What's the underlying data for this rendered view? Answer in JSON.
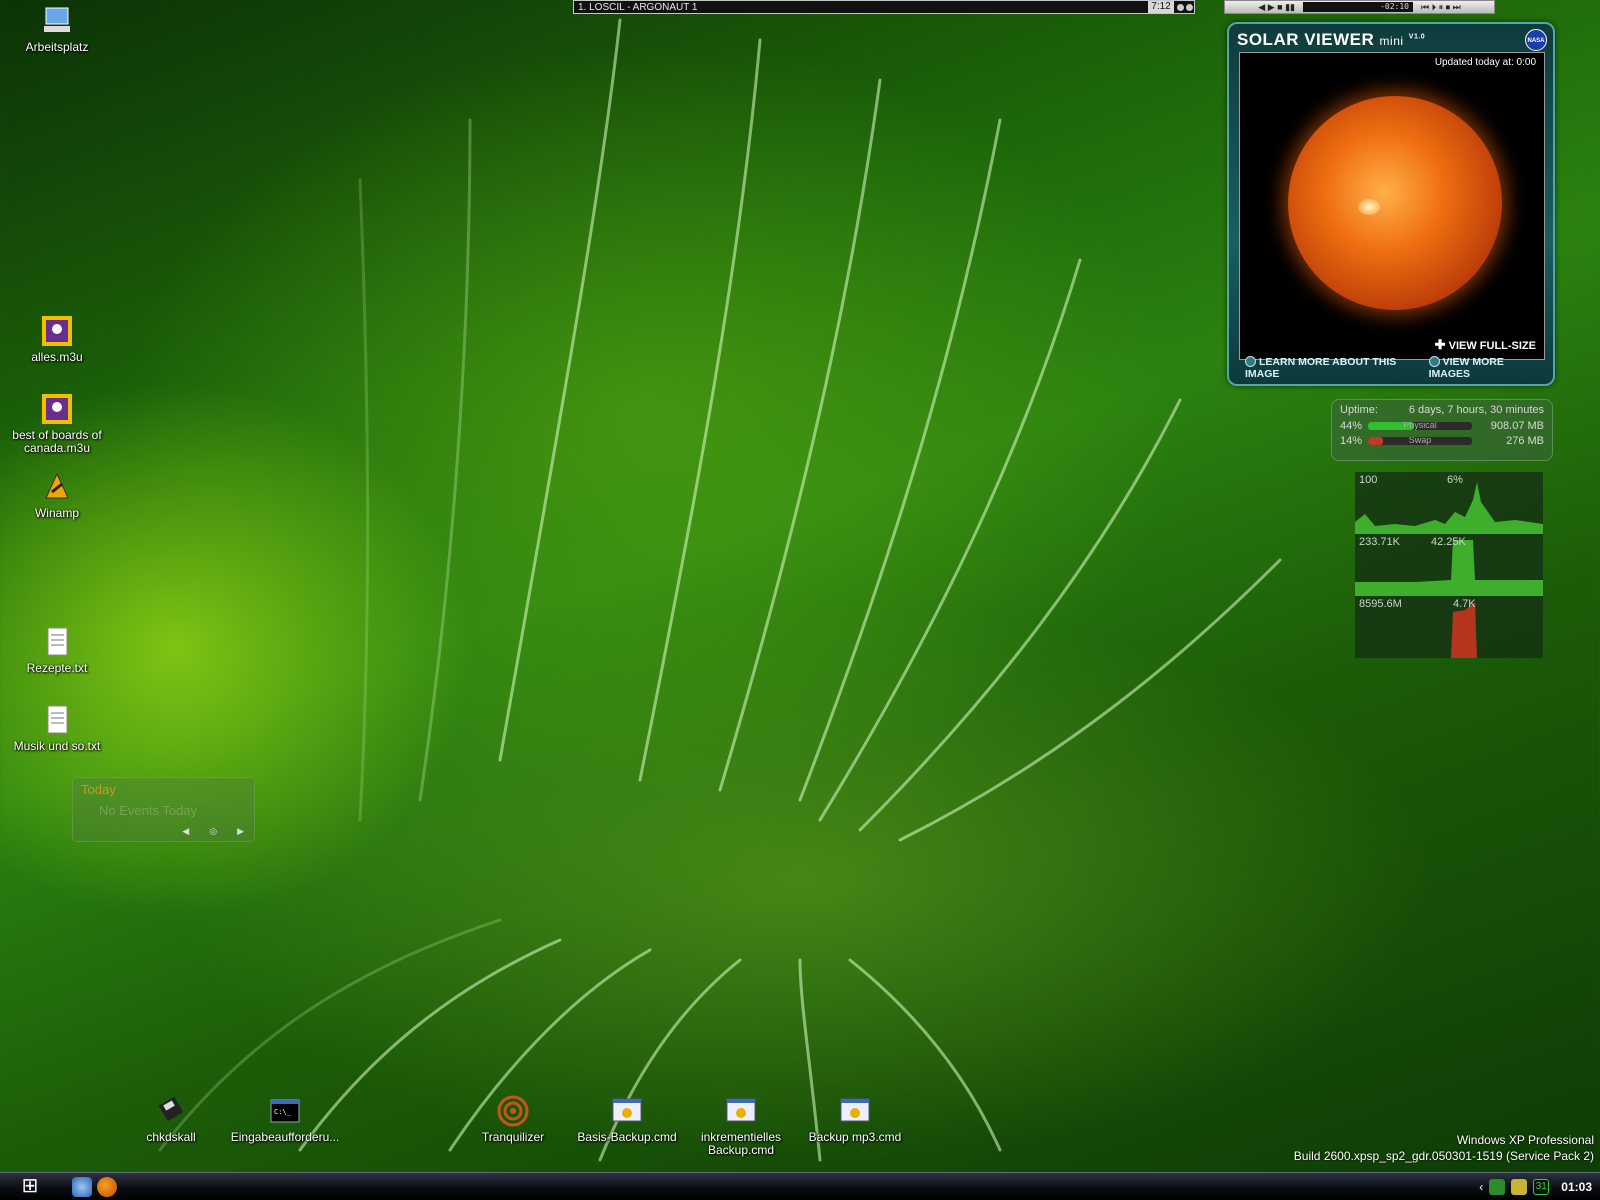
{
  "desktop_icons_left": [
    {
      "label": "Arbeitsplatz",
      "icon": "computer-icon"
    },
    {
      "label": "alles.m3u",
      "icon": "playlist-icon"
    },
    {
      "label": "best of boards of canada.m3u",
      "icon": "playlist-icon"
    },
    {
      "label": "Winamp",
      "icon": "winamp-icon"
    },
    {
      "label": "Rezepte.txt",
      "icon": "text-file-icon"
    },
    {
      "label": "Musik und so.txt",
      "icon": "text-file-icon"
    }
  ],
  "desktop_icons_bottom": [
    {
      "label": "chkdskall",
      "icon": "disk-shortcut-icon"
    },
    {
      "label": "Eingabeaufforderu...",
      "icon": "cmd-icon"
    },
    {
      "label": "Tranquilizer",
      "icon": "spiral-icon"
    },
    {
      "label": "Basis-Backup.cmd",
      "icon": "batch-file-icon"
    },
    {
      "label": "inkrementielles Backup.cmd",
      "icon": "batch-file-icon"
    },
    {
      "label": "Backup mp3.cmd",
      "icon": "batch-file-icon"
    }
  ],
  "winamp": {
    "track": "1. LOSCIL - ARGONAUT 1",
    "time": "7:12",
    "mini_display": "-02:10"
  },
  "solar_viewer": {
    "title": "SOLAR VIEWER",
    "title_suffix": "mini",
    "version": "V1.0",
    "badge": "NASA",
    "updated": "Updated today at: 0:00",
    "view_full": "VIEW FULL-SIZE",
    "link_learn": "LEARN MORE ABOUT THIS IMAGE",
    "link_more": "VIEW MORE IMAGES"
  },
  "uptime": {
    "label": "Uptime:",
    "value": "6 days, 7 hours, 30 minutes",
    "physical_pct": "44%",
    "physical_label": "Physical",
    "physical_value": "908.07 MB",
    "physical_fill": 0.44,
    "swap_pct": "14%",
    "swap_label": "Swap",
    "swap_value": "276 MB",
    "swap_fill": 0.14,
    "physical_color": "#2fbf2f",
    "swap_color": "#c0392b"
  },
  "perf": {
    "cpu_left": "100",
    "cpu_right": "6%",
    "net_left": "233.71K",
    "net_right": "42.25K",
    "disk_left": "8595.6M",
    "disk_right": "4.7K"
  },
  "calendar": {
    "title": "Today",
    "events": "No Events Today"
  },
  "os_info": {
    "line1": "Windows XP Professional",
    "line2": "Build 2600.xpsp_sp2_gdr.050301-1519 (Service Pack 2)"
  },
  "taskbar": {
    "clock": "01:03",
    "tray_day": "31"
  }
}
